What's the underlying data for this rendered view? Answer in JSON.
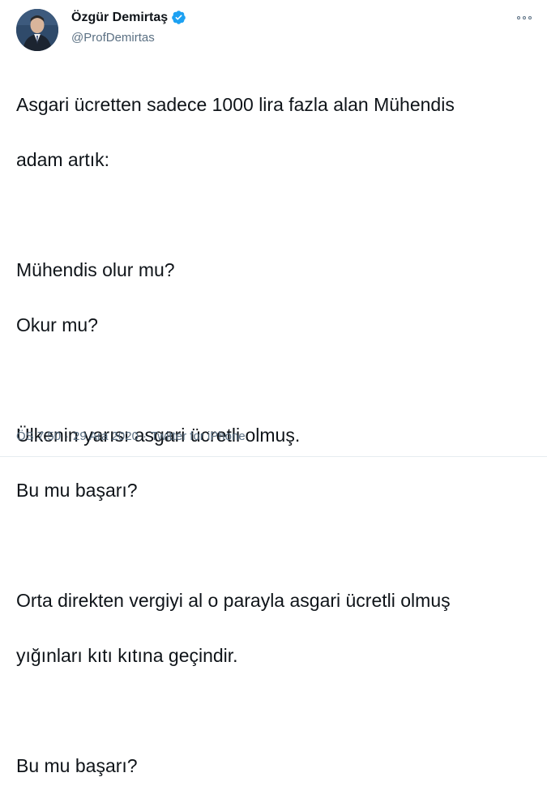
{
  "author": {
    "display_name": "Özgür Demirtaş",
    "handle": "@ProfDemirtas",
    "verified": true
  },
  "icons": {
    "avatar": "profile-photo",
    "verified": "verified-badge-icon",
    "more": "more-options-icon"
  },
  "colors": {
    "verified_blue": "#1da1f2",
    "text": "#0f1419",
    "secondary": "#5b7083"
  },
  "tweet": {
    "lines": [
      "Asgari ücretten sadece 1000 lira fazla alan Mühendis",
      "adam artık:",
      "",
      "Mühendis olur mu?",
      "Okur mu?",
      "",
      "Ülkenin yarısı asgari ücretli olmuş.",
      "Bu mu başarı?",
      "",
      "Orta direkten vergiyi al o parayla asgari ücretli olmuş",
      "yığınları kıtı kıtına geçindir.",
      "",
      "Bu mu başarı?"
    ]
  },
  "meta": {
    "time": "ÖS 7:50",
    "date": "29 Ara 2020",
    "source": "Twitter for iPhone",
    "separator": "·"
  }
}
